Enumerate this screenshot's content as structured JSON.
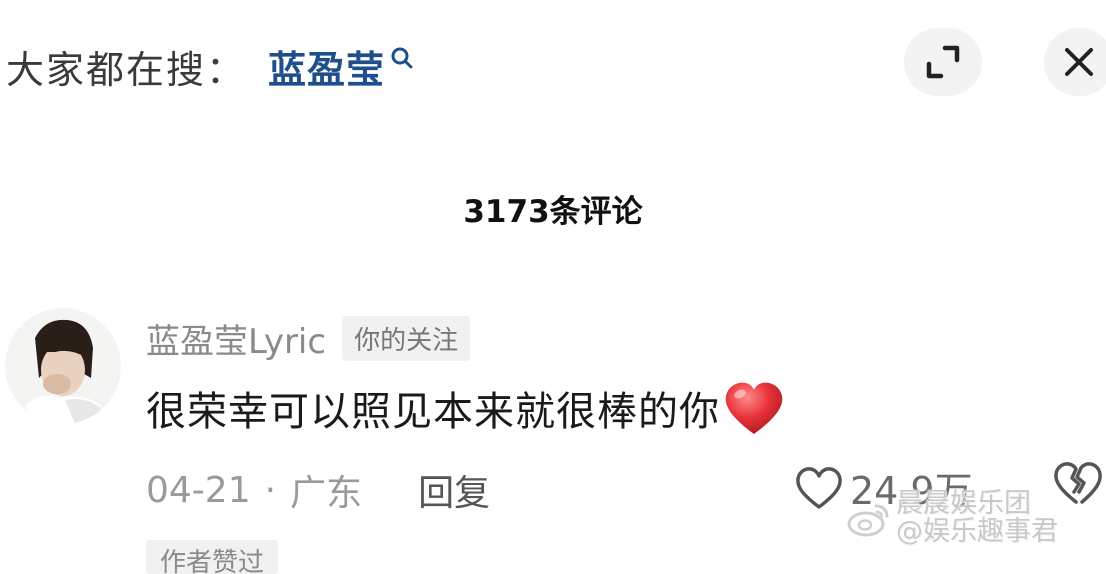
{
  "search": {
    "prefix": "大家都在搜：",
    "term": "蓝盈莹"
  },
  "comments": {
    "count_label": "3173条评论"
  },
  "comment": {
    "username": "蓝盈莹Lyric",
    "badge": "你的关注",
    "text": "很荣幸可以照见本来就很棒的你",
    "date": "04-21",
    "separator": "·",
    "location": "广东",
    "reply_label": "回复",
    "likes": "24.9万",
    "author_liked": "作者赞过"
  },
  "watermark": {
    "line1": "晨晨娱乐团",
    "line2": "@娱乐趣事君"
  },
  "icons": {
    "search": "search-icon",
    "expand": "expand-icon",
    "close": "close-icon",
    "heart_emoji": "red-heart-emoji",
    "like": "heart-outline-icon",
    "dislike": "broken-heart-icon",
    "weibo": "weibo-logo"
  },
  "colors": {
    "search_term": "#1e4f8a",
    "heart": "#e8323a",
    "muted": "#9a9a9a"
  }
}
